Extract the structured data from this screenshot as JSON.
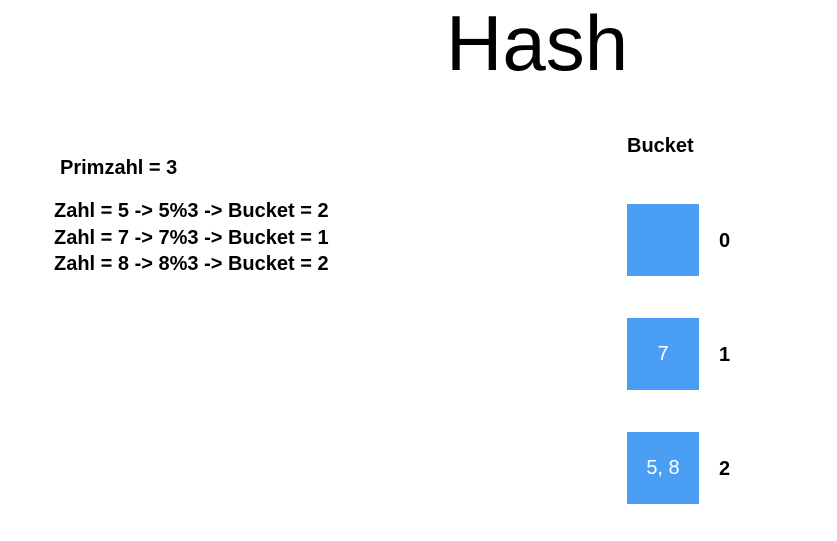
{
  "title": "Hash",
  "primzahl": "Primzahl = 3",
  "calculations": [
    "Zahl = 5 -> 5%3 -> Bucket = 2",
    "Zahl = 7 -> 7%3 -> Bucket = 1",
    "Zahl = 8 -> 8%3 -> Bucket = 2"
  ],
  "bucket_heading": "Bucket",
  "buckets": [
    {
      "index": "0",
      "content": ""
    },
    {
      "index": "1",
      "content": "7"
    },
    {
      "index": "2",
      "content": "5, 8"
    }
  ],
  "colors": {
    "bucket_fill": "#4a9ff5",
    "bucket_text": "#ffffff",
    "text": "#000000"
  }
}
